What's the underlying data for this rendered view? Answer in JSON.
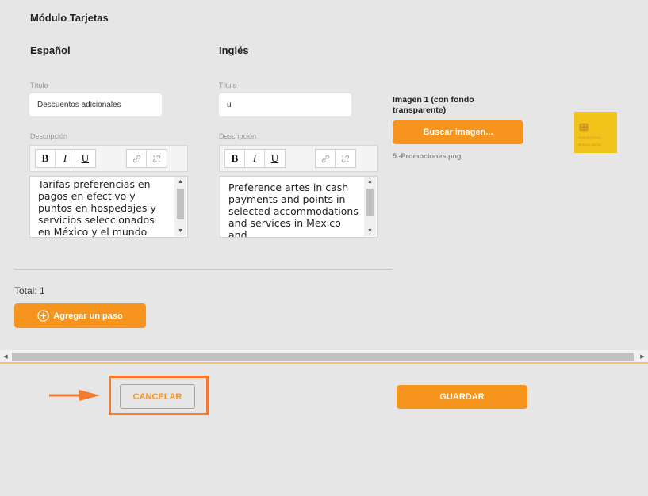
{
  "module": {
    "title": "Módulo Tarjetas"
  },
  "spanish": {
    "heading": "Español",
    "title_label": "Título",
    "title_value": "Descuentos adicionales",
    "description_label": "Descripción",
    "description_text": "Tarifas preferencias en pagos en efectivo y puntos en hospedajes y servicios seleccionados en México y el mundo"
  },
  "english": {
    "heading": "Inglés",
    "title_label": "Título",
    "title_value": "u",
    "description_label": "Descripción",
    "description_text": "Preference artes in cash payments and points in selected accommodations and services in Mexico and"
  },
  "toolbar": {
    "bold": "B",
    "italic": "I",
    "underline": "U"
  },
  "image": {
    "label": "Imagen 1 (con fondo transparente)",
    "search_button": "Buscar imagen...",
    "file_name": "5.-Promociones.png",
    "card_number_text": "1234 5678 9101",
    "card_name_text": "MORGAN IBAÑEZ"
  },
  "footer": {
    "total": "Total: 1",
    "add_step_button": "Agregar un paso",
    "cancel_button": "CANCELAR",
    "save_button": "GUARDAR"
  },
  "colors": {
    "accent": "#f7941d",
    "highlight": "#f47a30",
    "card": "#f2c31b"
  }
}
